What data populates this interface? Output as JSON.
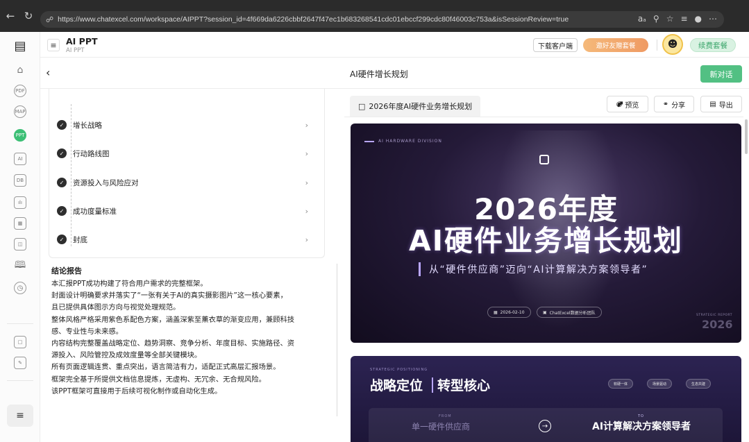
{
  "browser": {
    "back_icon": "←",
    "refresh_icon": "↻",
    "url": "https://www.chatexcel.com/workspace/AIPPT?session_id=4f669da6226cbbf2647f47ec1b683268541cdc01ebccf299cdc80f46003c753a&isSessionReview=true"
  },
  "header": {
    "title": "AI PPT",
    "subtitle": "AI PPT",
    "download_label": "下载客户端",
    "invite_label": "邀好友赠套餐",
    "renew_label": "续费套餐"
  },
  "subheader": {
    "document_title": "AI硬件增长规划",
    "new_chat_label": "新对话"
  },
  "outline": {
    "steps": [
      {
        "label": "增长战略"
      },
      {
        "label": "行动路线图"
      },
      {
        "label": "资源投入与风险应对"
      },
      {
        "label": "成功度量标准"
      },
      {
        "label": "封底"
      }
    ]
  },
  "conclusion": {
    "title": "结论报告",
    "lines": [
      "本汇报PPT成功构建了符合用户需求的完整框架。",
      "封面设计明确要求并落实了“一张有关于AI的真实摄影图片”这一核心要素，",
      "且已提供具体图示方向与视觉处理规范。",
      "整体风格严格采用紫色系配色方案，涵盖深紫至薰衣草的渐变应用，兼顾科技",
      "感、专业性与未来感。",
      "内容结构完整覆盖战略定位、趋势洞察、竞争分析、年度目标、实施路径、资",
      "源投入、风险管控及成效度量等全部关键模块。",
      "所有页面逻辑连贯、重点突出，语言简洁有力，适配正式高层汇报场景。",
      "框架完全基于所提供文档信息提炼，无虚构、无冗余、无合规风险。",
      "该PPT框架可直接用于后续可视化制作或自动化生成。"
    ]
  },
  "preview": {
    "tab_label": "2026年度AI硬件业务增长规划",
    "preview_label": "预览",
    "share_label": "分享",
    "export_label": "导出"
  },
  "slide1": {
    "kicker": "AI HARDWARE DIVISION",
    "year": "2026年度",
    "title": "AI硬件业务增长规划",
    "tagline": "从“硬件供应商”迈向“AI计算解决方案领导者”",
    "date_pill": "2026-02-10",
    "team_pill": "ChatExcel数据分析团队",
    "corner_label": "STRATEGIC REPORT",
    "corner_year": "2026"
  },
  "slide2": {
    "kicker": "STRATEGIC POSITIONING",
    "title_a": "战略定位",
    "title_b": "转型核心",
    "chips": [
      "软硬一体",
      "场景驱动",
      "生态共建"
    ],
    "from_label": "FROM",
    "from_value": "单一硬件供应商",
    "to_label": "TO",
    "to_value": "AI计算解决方案领导者"
  },
  "colors": {
    "accent_green": "#52c083",
    "slide_purple": "#241a38",
    "lavender": "#b9a6ff"
  }
}
